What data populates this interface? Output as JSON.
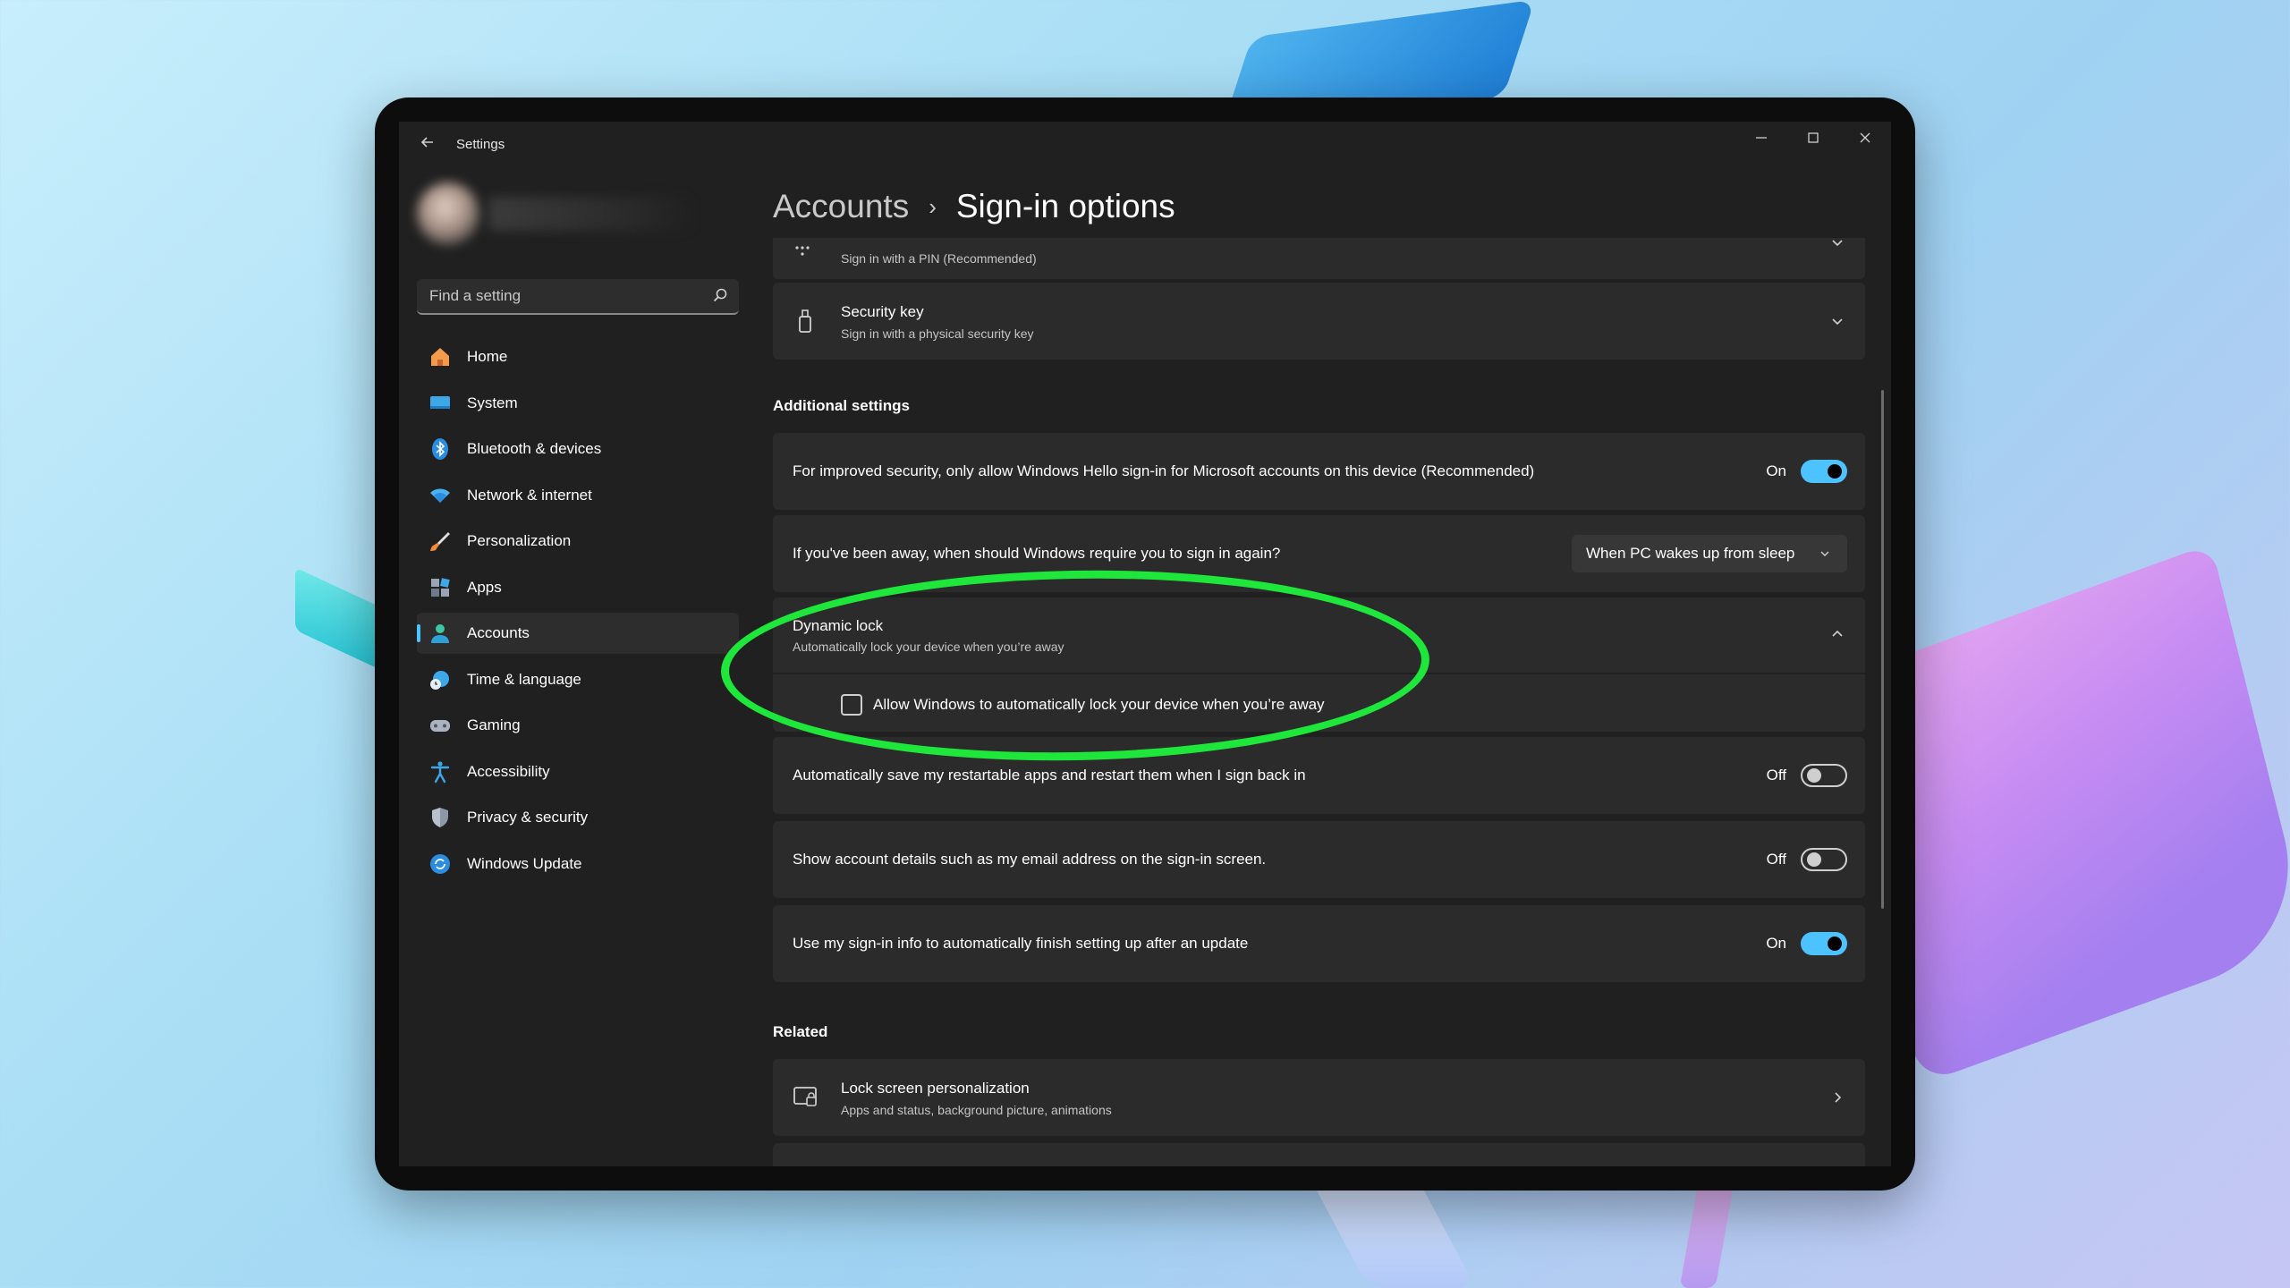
{
  "window": {
    "app_title": "Settings",
    "controls": {
      "minimize": "—",
      "maximize": "☐",
      "close": "✕"
    }
  },
  "search": {
    "placeholder": "Find a setting"
  },
  "sidebar": {
    "items": [
      {
        "label": "Home",
        "icon": "home-icon",
        "active": false
      },
      {
        "label": "System",
        "icon": "monitor-icon",
        "active": false
      },
      {
        "label": "Bluetooth & devices",
        "icon": "bluetooth-icon",
        "active": false
      },
      {
        "label": "Network & internet",
        "icon": "wifi-icon",
        "active": false
      },
      {
        "label": "Personalization",
        "icon": "brush-icon",
        "active": false
      },
      {
        "label": "Apps",
        "icon": "apps-icon",
        "active": false
      },
      {
        "label": "Accounts",
        "icon": "person-icon",
        "active": true
      },
      {
        "label": "Time & language",
        "icon": "globe-clock-icon",
        "active": false
      },
      {
        "label": "Gaming",
        "icon": "controller-icon",
        "active": false
      },
      {
        "label": "Accessibility",
        "icon": "accessibility-icon",
        "active": false
      },
      {
        "label": "Privacy & security",
        "icon": "shield-icon",
        "active": false
      },
      {
        "label": "Windows Update",
        "icon": "update-icon",
        "active": false
      }
    ]
  },
  "breadcrumb": {
    "parent": "Accounts",
    "separator": "›",
    "current": "Sign-in options"
  },
  "signin_methods": {
    "pin": {
      "subtitle": "Sign in with a PIN (Recommended)"
    },
    "security_key": {
      "title": "Security key",
      "subtitle": "Sign in with a physical security key"
    }
  },
  "additional": {
    "heading": "Additional settings",
    "hello_only": {
      "label": "For improved security, only allow Windows Hello sign-in for Microsoft accounts on this device (Recommended)",
      "state": "On"
    },
    "require_signin": {
      "label": "If you've been away, when should Windows require you to sign in again?",
      "value": "When PC wakes up from sleep"
    },
    "dynamic_lock": {
      "title": "Dynamic lock",
      "subtitle": "Automatically lock your device when you’re away",
      "checkbox_label": "Allow Windows to automatically lock your device when you’re away",
      "checked": false
    },
    "restart_apps": {
      "label": "Automatically save my restartable apps and restart them when I sign back in",
      "state": "Off"
    },
    "account_details": {
      "label": "Show account details such as my email address on the sign-in screen.",
      "state": "Off"
    },
    "finish_setup": {
      "label": "Use my sign-in info to automatically finish setting up after an update",
      "state": "On"
    }
  },
  "related": {
    "heading": "Related",
    "lock_screen": {
      "title": "Lock screen personalization",
      "subtitle": "Apps and status, background picture, animations"
    }
  },
  "colors": {
    "accent": "#4cc2ff",
    "highlight": "#1ee63a",
    "window_bg": "#202020",
    "card_bg": "#2b2b2b"
  }
}
